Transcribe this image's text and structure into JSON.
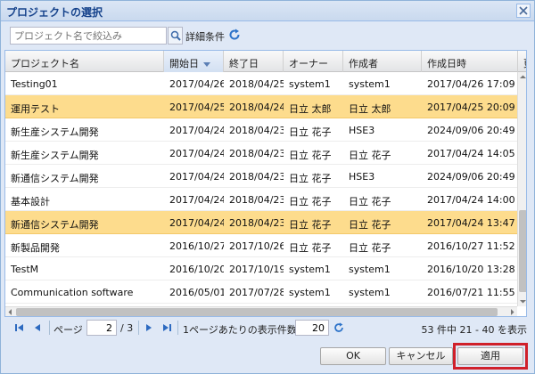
{
  "dialog": {
    "title": "プロジェクトの選択"
  },
  "toolbar": {
    "search_placeholder": "プロジェクト名で絞込み",
    "detail_label": "詳細条件"
  },
  "grid": {
    "columns": [
      "プロジェクト名",
      "開始日",
      "終了日",
      "オーナー",
      "作成者",
      "作成日時",
      "更"
    ],
    "sorted_column": "開始日",
    "rows": [
      {
        "name": "Testing01",
        "start": "2017/04/26",
        "end": "2018/04/25",
        "owner": "system1",
        "creator": "system1",
        "created": "2017/04/26 17:09",
        "selected": false
      },
      {
        "name": "運用テスト",
        "start": "2017/04/25",
        "end": "2018/04/24",
        "owner": "日立 太郎",
        "creator": "日立 太郎",
        "created": "2017/04/25 20:09",
        "selected": true
      },
      {
        "name": "新生産システム開発",
        "start": "2017/04/24",
        "end": "2018/04/23",
        "owner": "日立 花子",
        "creator": "HSE3",
        "created": "2024/09/06 20:49",
        "selected": false
      },
      {
        "name": "新生産システム開発",
        "start": "2017/04/24",
        "end": "2018/04/23",
        "owner": "日立 花子",
        "creator": "日立 花子",
        "created": "2017/04/24 14:05",
        "selected": false
      },
      {
        "name": "新通信システム開発",
        "start": "2017/04/24",
        "end": "2018/04/23",
        "owner": "日立 花子",
        "creator": "HSE3",
        "created": "2024/09/06 20:49",
        "selected": false
      },
      {
        "name": "基本設計",
        "start": "2017/04/24",
        "end": "2018/04/23",
        "owner": "日立 花子",
        "creator": "日立 花子",
        "created": "2017/04/24 14:00",
        "selected": false
      },
      {
        "name": "新通信システム開発",
        "start": "2017/04/24",
        "end": "2018/04/23",
        "owner": "日立 花子",
        "creator": "日立 花子",
        "created": "2017/04/24 13:47",
        "selected": true
      },
      {
        "name": "新製品開発",
        "start": "2016/10/27",
        "end": "2017/10/26",
        "owner": "日立 花子",
        "creator": "日立 花子",
        "created": "2016/10/27 11:52",
        "selected": false
      },
      {
        "name": "TestM",
        "start": "2016/10/20",
        "end": "2017/10/19",
        "owner": "system1",
        "creator": "system1",
        "created": "2016/10/20 13:28",
        "selected": false
      },
      {
        "name": "Communication software",
        "start": "2016/05/01",
        "end": "2017/07/28",
        "owner": "system1",
        "creator": "system1",
        "created": "2016/07/21 11:55",
        "selected": false
      }
    ]
  },
  "pager": {
    "page_label": "ページ",
    "current_page": "2",
    "total_pages": "/ 3",
    "per_page_label": "1ページあたりの表示件数",
    "per_page": "20",
    "range_info": "53 件中 21 - 40 を表示"
  },
  "buttons": {
    "ok": "OK",
    "cancel": "キャンセル",
    "apply": "適用"
  },
  "colors": {
    "selected_row": "#fddc8d",
    "highlight_border": "#d0202a",
    "title_text": "#15428b"
  }
}
